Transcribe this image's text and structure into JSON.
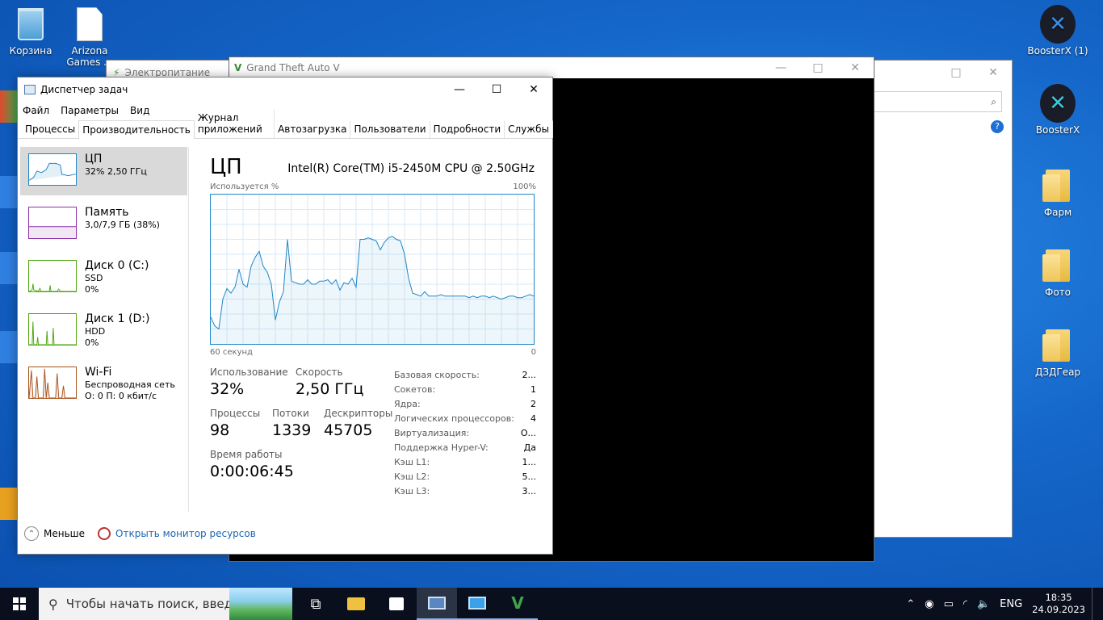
{
  "desktop": {
    "icons_left": [
      {
        "label": "Корзина",
        "icon": "recycle-bin-icon"
      },
      {
        "label": "Arizona Games ...",
        "icon": "shortcut-file-icon"
      }
    ],
    "icons_right": [
      {
        "label": "BoosterX (1)",
        "icon": "boosterx-icon"
      },
      {
        "label": "BoosterX",
        "icon": "boosterx-icon"
      },
      {
        "label": "Фарм",
        "icon": "folder-icon"
      },
      {
        "label": "Фото",
        "icon": "folder-icon"
      },
      {
        "label": "ДЗДГеар",
        "icon": "folder-icon"
      }
    ]
  },
  "bg_windows": {
    "power_title": "Электропитание",
    "gta_title": "Grand Theft Auto V"
  },
  "task_manager": {
    "title": "Диспетчер задач",
    "menu": [
      "Файл",
      "Параметры",
      "Вид"
    ],
    "tabs": [
      "Процессы",
      "Производительность",
      "Журнал приложений",
      "Автозагрузка",
      "Пользователи",
      "Подробности",
      "Службы"
    ],
    "active_tab": "Производительность",
    "sidebar": [
      {
        "name": "ЦП",
        "sub1": "32% 2,50 ГГц",
        "sub2": "",
        "color": "#1e86c8"
      },
      {
        "name": "Память",
        "sub1": "3,0/7,9 ГБ (38%)",
        "sub2": "",
        "color": "#8b2fa8"
      },
      {
        "name": "Диск 0 (C:)",
        "sub1": "SSD",
        "sub2": "0%",
        "color": "#4da60c"
      },
      {
        "name": "Диск 1 (D:)",
        "sub1": "HDD",
        "sub2": "0%",
        "color": "#4da60c"
      },
      {
        "name": "Wi-Fi",
        "sub1": "Беспроводная сеть",
        "sub2": "О: 0 П: 0 кбит/с",
        "color": "#a8521b"
      }
    ],
    "cpu": {
      "title": "ЦП",
      "model": "Intel(R) Core(TM) i5-2450M CPU @ 2.50GHz",
      "usage_label": "Используется %",
      "max_label": "100%",
      "time_label": "60 секунд",
      "zero_label": "0",
      "stats": {
        "usage_lbl": "Использование",
        "usage_val": "32%",
        "speed_lbl": "Скорость",
        "speed_val": "2,50 ГГц",
        "proc_lbl": "Процессы",
        "proc_val": "98",
        "threads_lbl": "Потоки",
        "threads_val": "1339",
        "handles_lbl": "Дескрипторы",
        "handles_val": "45705",
        "uptime_lbl": "Время работы",
        "uptime_val": "0:00:06:45"
      },
      "details": [
        {
          "k": "Базовая скорость:",
          "v": "2..."
        },
        {
          "k": "Сокетов:",
          "v": "1"
        },
        {
          "k": "Ядра:",
          "v": "2"
        },
        {
          "k": "Логических процессоров:",
          "v": "4"
        },
        {
          "k": "Виртуализация:",
          "v": "О..."
        },
        {
          "k": "Поддержка Hyper-V:",
          "v": "Да"
        },
        {
          "k": "Кэш L1:",
          "v": "1..."
        },
        {
          "k": "Кэш L2:",
          "v": "5..."
        },
        {
          "k": "Кэш L3:",
          "v": "3..."
        }
      ],
      "graph_values": [
        18,
        12,
        10,
        30,
        37,
        34,
        38,
        50,
        40,
        38,
        52,
        58,
        62,
        52,
        48,
        40,
        16,
        28,
        35,
        70,
        42,
        41,
        40,
        40,
        43,
        40,
        40,
        42,
        42,
        43,
        40,
        43,
        36,
        41,
        40,
        44,
        38,
        70,
        70,
        71,
        70,
        69,
        63,
        68,
        71,
        72,
        70,
        69,
        60,
        44,
        34,
        33,
        32,
        35,
        32,
        32,
        32,
        33,
        32,
        32,
        32,
        32,
        32,
        32,
        31,
        32,
        31,
        32,
        32,
        31,
        32,
        31,
        30,
        31,
        32,
        32,
        31,
        31,
        32,
        33,
        32
      ]
    },
    "footer": {
      "less": "Меньше",
      "monitor": "Открыть монитор ресурсов"
    }
  },
  "taskbar": {
    "search_placeholder": "Чтобы начать поиск, введите",
    "apps": [
      "task-view-icon",
      "file-explorer-icon",
      "store-icon",
      "task-manager-icon",
      "control-panel-icon",
      "gta-icon"
    ],
    "lang": "ENG",
    "time": "18:35",
    "date": "24.09.2023"
  }
}
